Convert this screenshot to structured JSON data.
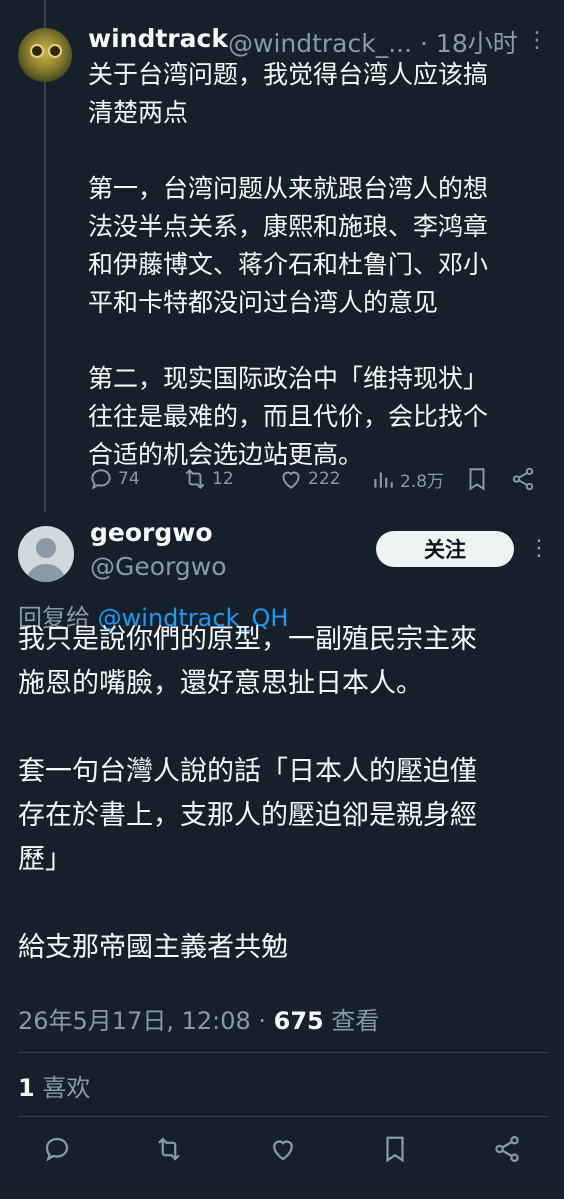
{
  "tweet1": {
    "author_name": "windtrack",
    "author_handle": "@windtrack_...",
    "time": "· 18小时",
    "lines": [
      "关于台湾问题，我觉得台湾人应该搞",
      "清楚两点",
      "",
      "第一，台湾问题从来就跟台湾人的想",
      "法没半点关系，康熙和施琅、李鸿章",
      "和伊藤博文、蒋介石和杜鲁门、邓小",
      "平和卡特都没问过台湾人的意见",
      "",
      "第二，现实国际政治中「维持现状」",
      "往往是最难的，而且代价，会比找个",
      "合适的机会选边站更高。"
    ],
    "replies": "74",
    "retweets": "12",
    "likes": "222",
    "views": "2.8万"
  },
  "tweet2": {
    "author_name": "georgwo",
    "author_handle": "@Georgwo",
    "follow_label": "关注",
    "reply_prefix": "回复给",
    "reply_to": "@windtrack_QH",
    "lines": [
      "我只是說你們的原型，一副殖民宗主來",
      "施恩的嘴臉，還好意思扯日本人。",
      "",
      "套一句台灣人說的話「日本人的壓迫僅",
      "存在於書上，支那人的壓迫卻是親身經",
      "歷」",
      "",
      "給支那帝國主義者共勉"
    ],
    "timestamp": "26年5月17日, 12:08 · ",
    "view_count": "675",
    "view_label": " 查看",
    "like_count": "1",
    "like_label": " 喜欢"
  },
  "colors": {
    "background": "#15202b",
    "text": "#f7f9f9",
    "muted": "#8b98a5",
    "link": "#1d9bf0",
    "divider": "#38444d"
  },
  "icons": [
    "reply-icon",
    "retweet-icon",
    "like-icon",
    "views-icon",
    "bookmark-icon",
    "share-icon",
    "more-icon"
  ]
}
